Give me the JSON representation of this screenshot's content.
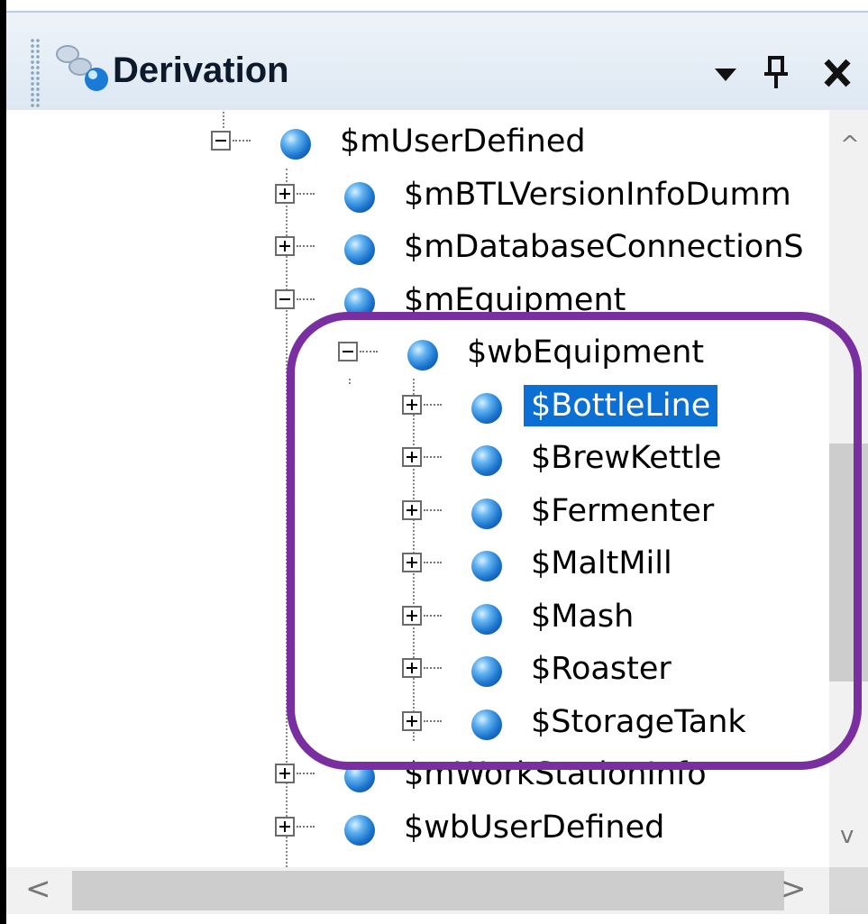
{
  "panel": {
    "title": "Derivation",
    "title_icon": "derivation-nodes-icon",
    "buttons": {
      "dropdown_icon": "dropdown-arrow-icon",
      "pin_icon": "pin-icon",
      "close_icon": "close-icon"
    }
  },
  "tree": {
    "nodes": [
      {
        "label": "$mUserDefined",
        "depth": 0,
        "expander": "minus",
        "selected": false
      },
      {
        "label": "$mBTLVersionInfoDumm",
        "depth": 1,
        "expander": "plus",
        "selected": false
      },
      {
        "label": "$mDatabaseConnectionS",
        "depth": 1,
        "expander": "plus",
        "selected": false
      },
      {
        "label": "$mEquipment",
        "depth": 1,
        "expander": "minus",
        "selected": false
      },
      {
        "label": "$wbEquipment",
        "depth": 2,
        "expander": "minus",
        "selected": false
      },
      {
        "label": "$BottleLine",
        "depth": 3,
        "expander": "plus",
        "selected": true
      },
      {
        "label": "$BrewKettle",
        "depth": 3,
        "expander": "plus",
        "selected": false
      },
      {
        "label": "$Fermenter",
        "depth": 3,
        "expander": "plus",
        "selected": false
      },
      {
        "label": "$MaltMill",
        "depth": 3,
        "expander": "plus",
        "selected": false
      },
      {
        "label": "$Mash",
        "depth": 3,
        "expander": "plus",
        "selected": false
      },
      {
        "label": "$Roaster",
        "depth": 3,
        "expander": "plus",
        "selected": false
      },
      {
        "label": "$StorageTank",
        "depth": 3,
        "expander": "plus",
        "selected": false
      },
      {
        "label": "$mWorkStationInfo",
        "depth": 1,
        "expander": "plus",
        "selected": false
      },
      {
        "label": "$wbUserDefined",
        "depth": 1,
        "expander": "plus",
        "selected": false
      }
    ]
  },
  "scrollbars": {
    "vertical": {
      "up_icon": "scroll-up-chevron-icon",
      "down_icon": "scroll-down-chevron-icon"
    },
    "horizontal": {
      "left_icon": "scroll-left-chevron-icon",
      "right_icon": "scroll-right-chevron-icon"
    }
  },
  "colors": {
    "selection": "#0b6fd3",
    "annotation_outline": "#7a2fa0",
    "titlebar": "#dde8f3"
  }
}
